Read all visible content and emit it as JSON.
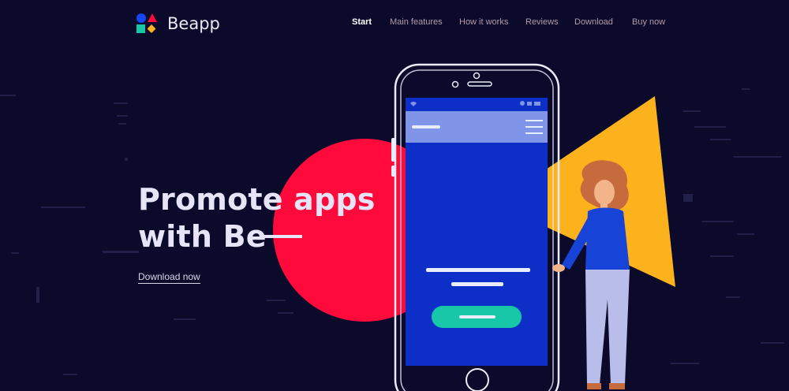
{
  "brand": {
    "name": "Beapp"
  },
  "nav": {
    "items": [
      {
        "label": "Start",
        "active": true
      },
      {
        "label": "Main features",
        "active": false
      },
      {
        "label": "How it works",
        "active": false
      },
      {
        "label": "Reviews",
        "active": false
      },
      {
        "label": "Download",
        "active": false
      },
      {
        "label": "Buy now",
        "active": false
      }
    ]
  },
  "hero": {
    "title_line1": "Promote apps",
    "title_line2": "with Be",
    "cta_label": "Download now"
  },
  "colors": {
    "background": "#0b0a2a",
    "accent_red": "#ff0a3a",
    "accent_yellow": "#fbb21d",
    "screen_blue": "#0d2fc7",
    "screen_header": "#8094e8",
    "button_teal": "#18c7a8",
    "logo_blue": "#1646f2",
    "logo_red": "#ff0a3a",
    "logo_teal": "#18c7a8",
    "logo_yellow": "#fbb21d"
  },
  "icons": [
    "logo-mark",
    "menu-hamburger-icon",
    "wifi-icon",
    "battery-icon",
    "home-button-icon",
    "camera-icon"
  ]
}
